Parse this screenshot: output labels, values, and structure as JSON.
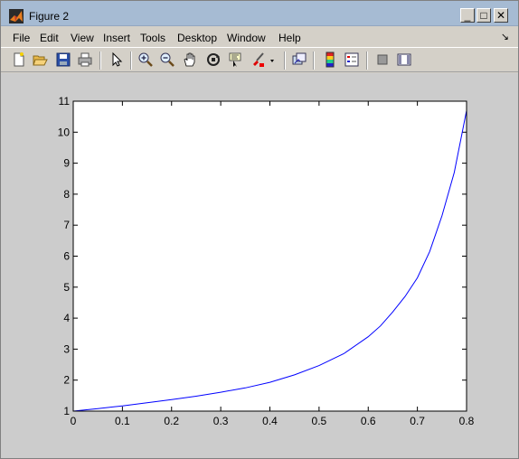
{
  "window": {
    "title": "Figure 2",
    "minimize_glyph": "_",
    "maximize_glyph": "□",
    "close_glyph": "✕"
  },
  "menu": {
    "items": [
      "File",
      "Edit",
      "View",
      "Insert",
      "Tools",
      "Desktop",
      "Window",
      "Help"
    ],
    "dock_glyph": "↘"
  },
  "toolbar": {
    "icons": [
      "new-figure-icon",
      "open-file-icon",
      "save-figure-icon",
      "print-figure-icon",
      "edit-plot-icon",
      "zoom-in-icon",
      "zoom-out-icon",
      "pan-icon",
      "rotate-3d-icon",
      "data-cursor-icon",
      "brush-icon",
      "brush-menu-icon",
      "link-plot-icon",
      "insert-colorbar-icon",
      "insert-legend-icon",
      "hide-plot-tools-icon",
      "show-plot-tools-icon"
    ]
  },
  "colors": {
    "line": "#0000ff",
    "figure_background": "#cccccc",
    "axes_background": "#ffffff",
    "title_bar": "#a6bbd3"
  },
  "chart_data": {
    "type": "line",
    "title": "",
    "xlabel": "",
    "ylabel": "",
    "xlim": [
      0,
      0.8
    ],
    "ylim": [
      1,
      11
    ],
    "xticks": [
      "0",
      "0.1",
      "0.2",
      "0.3",
      "0.4",
      "0.5",
      "0.6",
      "0.7",
      "0.8"
    ],
    "yticks": [
      "1",
      "2",
      "3",
      "4",
      "5",
      "6",
      "7",
      "8",
      "9",
      "10",
      "11"
    ],
    "grid": false,
    "series": [
      {
        "x": [
          0,
          0.05,
          0.1,
          0.15,
          0.2,
          0.25,
          0.3,
          0.35,
          0.4,
          0.45,
          0.5,
          0.55,
          0.6,
          0.625,
          0.65,
          0.675,
          0.7,
          0.725,
          0.75,
          0.775,
          0.8
        ],
        "y": [
          1.0,
          1.08,
          1.17,
          1.27,
          1.37,
          1.48,
          1.61,
          1.75,
          1.93,
          2.17,
          2.47,
          2.85,
          3.4,
          3.75,
          4.2,
          4.7,
          5.3,
          6.15,
          7.3,
          8.7,
          10.7
        ]
      }
    ]
  }
}
